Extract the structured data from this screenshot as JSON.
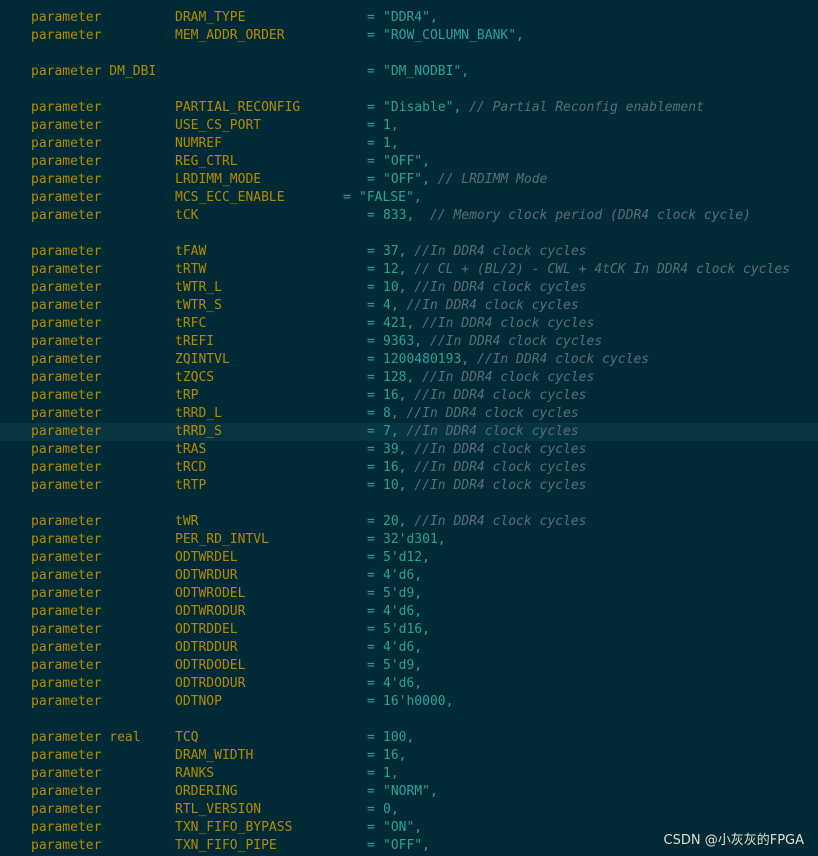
{
  "lines": [
    {
      "kw": "parameter",
      "name": "DRAM_TYPE",
      "op": "=",
      "val": "\"DDR4\",",
      "comment": ""
    },
    {
      "kw": "parameter",
      "name": "MEM_ADDR_ORDER",
      "op": "=",
      "val": "\"ROW_COLUMN_BANK\",",
      "comment": ""
    },
    {
      "blank": true
    },
    {
      "kw": "parameter DM_DBI",
      "name": "",
      "op": "=",
      "val": "\"DM_NODBI\",",
      "comment": ""
    },
    {
      "blank": true
    },
    {
      "kw": "parameter",
      "name": "PARTIAL_RECONFIG",
      "op": "=",
      "val": "\"Disable\",",
      "comment": "// Partial Reconfig enablement"
    },
    {
      "kw": "parameter",
      "name": "USE_CS_PORT",
      "op": "=",
      "val": "1,",
      "comment": ""
    },
    {
      "kw": "parameter",
      "name": "NUMREF",
      "op": "=",
      "val": "1,",
      "comment": ""
    },
    {
      "kw": "parameter",
      "name": "REG_CTRL",
      "op": "=",
      "val": "\"OFF\",",
      "comment": ""
    },
    {
      "kw": "parameter",
      "name": "LRDIMM_MODE",
      "op": "=",
      "val": "\"OFF\",",
      "comment": "// LRDIMM Mode"
    },
    {
      "kw": "parameter",
      "name": "MCS_ECC_ENABLE",
      "op": "=",
      "val": "\"FALSE\",",
      "comment": "",
      "opShift": true
    },
    {
      "kw": "parameter",
      "name": "tCK",
      "op": "=",
      "val": "833,",
      "comment": " // Memory clock period (DDR4 clock cycle)"
    },
    {
      "blank": true
    },
    {
      "kw": "parameter",
      "name": "tFAW",
      "op": "=",
      "val": "37,",
      "comment": "//In DDR4 clock cycles"
    },
    {
      "kw": "parameter",
      "name": "tRTW",
      "op": "=",
      "val": "12,",
      "comment": "// CL + (BL/2) - CWL + 4tCK In DDR4 clock cycles"
    },
    {
      "kw": "parameter",
      "name": "tWTR_L",
      "op": "=",
      "val": "10,",
      "comment": "//In DDR4 clock cycles"
    },
    {
      "kw": "parameter",
      "name": "tWTR_S",
      "op": "=",
      "val": "4,",
      "comment": "//In DDR4 clock cycles"
    },
    {
      "kw": "parameter",
      "name": "tRFC",
      "op": "=",
      "val": "421,",
      "comment": "//In DDR4 clock cycles"
    },
    {
      "kw": "parameter",
      "name": "tREFI",
      "op": "=",
      "val": "9363,",
      "comment": "//In DDR4 clock cycles"
    },
    {
      "kw": "parameter",
      "name": "ZQINTVL",
      "op": "=",
      "val": "1200480193,",
      "comment": "//In DDR4 clock cycles"
    },
    {
      "kw": "parameter",
      "name": "tZQCS",
      "op": "=",
      "val": "128,",
      "comment": "//In DDR4 clock cycles"
    },
    {
      "kw": "parameter",
      "name": "tRP",
      "op": "=",
      "val": "16,",
      "comment": "//In DDR4 clock cycles"
    },
    {
      "kw": "parameter",
      "name": "tRRD_L",
      "op": "=",
      "val": "8,",
      "comment": "//In DDR4 clock cycles"
    },
    {
      "kw": "parameter",
      "name": "tRRD_S",
      "op": "=",
      "val": "7,",
      "comment": "//In DDR4 clock cycles",
      "highlight": true
    },
    {
      "kw": "parameter",
      "name": "tRAS",
      "op": "=",
      "val": "39,",
      "comment": "//In DDR4 clock cycles"
    },
    {
      "kw": "parameter",
      "name": "tRCD",
      "op": "=",
      "val": "16,",
      "comment": "//In DDR4 clock cycles"
    },
    {
      "kw": "parameter",
      "name": "tRTP",
      "op": "=",
      "val": "10,",
      "comment": "//In DDR4 clock cycles"
    },
    {
      "blank": true
    },
    {
      "kw": "parameter",
      "name": "tWR",
      "op": "=",
      "val": "20,",
      "comment": "//In DDR4 clock cycles"
    },
    {
      "kw": "parameter",
      "name": "PER_RD_INTVL",
      "op": "=",
      "val": "32'd301,",
      "comment": ""
    },
    {
      "kw": "parameter",
      "name": "ODTWRDEL",
      "op": "=",
      "val": "5'd12,",
      "comment": ""
    },
    {
      "kw": "parameter",
      "name": "ODTWRDUR",
      "op": "=",
      "val": "4'd6,",
      "comment": ""
    },
    {
      "kw": "parameter",
      "name": "ODTWRODEL",
      "op": "=",
      "val": "5'd9,",
      "comment": ""
    },
    {
      "kw": "parameter",
      "name": "ODTWRODUR",
      "op": "=",
      "val": "4'd6,",
      "comment": ""
    },
    {
      "kw": "parameter",
      "name": "ODTRDDEL",
      "op": "=",
      "val": "5'd16,",
      "comment": ""
    },
    {
      "kw": "parameter",
      "name": "ODTRDDUR",
      "op": "=",
      "val": "4'd6,",
      "comment": ""
    },
    {
      "kw": "parameter",
      "name": "ODTRDODEL",
      "op": "=",
      "val": "5'd9,",
      "comment": ""
    },
    {
      "kw": "parameter",
      "name": "ODTRDODUR",
      "op": "=",
      "val": "4'd6,",
      "comment": ""
    },
    {
      "kw": "parameter",
      "name": "ODTNOP",
      "op": "=",
      "val": "16'h0000,",
      "comment": ""
    },
    {
      "blank": true
    },
    {
      "kw": "parameter real",
      "name": "TCQ",
      "op": "=",
      "val": "100,",
      "comment": ""
    },
    {
      "kw": "parameter",
      "name": "DRAM_WIDTH",
      "op": "=",
      "val": "16,",
      "comment": ""
    },
    {
      "kw": "parameter",
      "name": "RANKS",
      "op": "=",
      "val": "1,",
      "comment": ""
    },
    {
      "kw": "parameter",
      "name": "ORDERING",
      "op": "=",
      "val": "\"NORM\",",
      "comment": ""
    },
    {
      "kw": "parameter",
      "name": "RTL_VERSION",
      "op": "=",
      "val": "0,",
      "comment": ""
    },
    {
      "kw": "parameter",
      "name": "TXN_FIFO_BYPASS",
      "op": "=",
      "val": "\"ON\",",
      "comment": ""
    },
    {
      "kw": "parameter",
      "name": "TXN_FIFO_PIPE",
      "op": "=",
      "val": "\"OFF\",",
      "comment": ""
    }
  ],
  "watermark": "CSDN @小灰灰的FPGA",
  "colors": {
    "background": "#002b36",
    "highlight_line": "#073642",
    "keyword": "#b58900",
    "value": "#2aa198",
    "comment": "#586e75"
  }
}
